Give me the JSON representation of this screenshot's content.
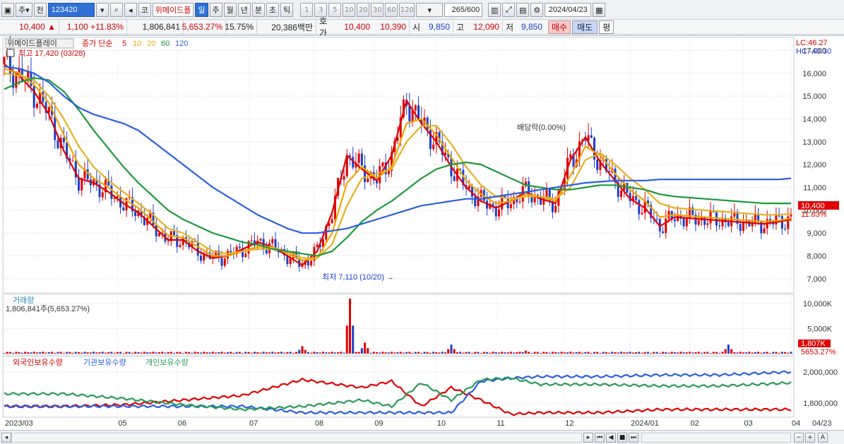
{
  "toolbar": {
    "chart_type": "주",
    "market": "전",
    "stock_code": "123420",
    "stock_name": "위메이드플",
    "periods": [
      "일",
      "주",
      "월",
      "년",
      "분",
      "초",
      "틱"
    ],
    "active_period": "일",
    "intervals": [
      "1",
      "3",
      "5",
      "10",
      "20",
      "30",
      "60",
      "120"
    ],
    "count": "265",
    "count_max": "/600",
    "date": "2024/04/23"
  },
  "quote": {
    "price": "10,400",
    "change": "1,100",
    "change_pct": "+11.83%",
    "volume": "1,806,841",
    "volume_ratio": "5,653.27%",
    "turnover": "15.75%",
    "amount": "20,386백만",
    "bid_label": "호가",
    "bid1": "10,400",
    "bid2": "10,390",
    "open_label": "시",
    "open": "9,850",
    "high_label": "고",
    "high": "12,090",
    "low_label": "저",
    "low": "9,850",
    "buy": "매수",
    "sell": "매도",
    "eval": "평"
  },
  "colors": {
    "up": "#e00000",
    "down": "#1a3fcf",
    "ma5": "#e00000",
    "ma10": "#f0a500",
    "ma20": "#e8b020",
    "ma60": "#1a9a3a",
    "ma120": "#2a5fe0",
    "foreign": "#e00000",
    "institution": "#2a5fe0",
    "individual": "#2a9a5a"
  },
  "price_panel": {
    "legend_name": "위메이드플레이",
    "legend_main": "종가 단순",
    "ma_labels": [
      "5",
      "10",
      "20",
      "60",
      "120"
    ],
    "high_note": "최고 17,420 (03/28)",
    "low_note": "최저 7,110 (10/20) →",
    "dividend_note": "배당락(0.00%)",
    "lc": "LC:46.27",
    "hc": "HC:-40.30",
    "last_price_tag": "10,400",
    "last_pct_tag": "11.83%"
  },
  "volume_panel": {
    "title": "거래량",
    "value": "1,806,841주(5,653.27%)",
    "tag_value": "1,807K",
    "tag_pct": "5653.27%"
  },
  "holdings_panel": {
    "legend": [
      "외국인보유수량",
      "기관보유수량",
      "개인보유수량"
    ]
  },
  "x_axis": {
    "labels": [
      "2023/03",
      "05",
      "06",
      "07",
      "08",
      "09",
      "10",
      "11",
      "12",
      "2024/01",
      "02",
      "03",
      "04",
      "04/23"
    ]
  },
  "chart_data": [
    {
      "type": "line",
      "name": "price",
      "ylim": [
        6500,
        17200
      ],
      "yticks": [
        "7,000",
        "8,000",
        "9,000",
        "10,000",
        "11,000",
        "12,000",
        "13,000",
        "14,000",
        "15,000",
        "16,000",
        "17,000"
      ],
      "x": [
        0,
        5,
        10,
        15,
        20,
        25,
        30,
        35,
        40,
        45,
        50,
        55,
        60,
        65,
        70,
        75,
        80,
        85,
        90,
        95,
        100,
        105,
        110,
        115,
        120,
        125,
        130,
        135,
        140,
        145,
        150,
        155,
        160,
        165,
        170,
        175,
        180,
        185,
        190,
        195,
        200,
        205,
        210,
        215,
        220,
        225,
        230,
        235,
        240,
        245,
        250,
        255,
        260,
        264
      ],
      "series": [
        {
          "name": "5",
          "values": [
            16400,
            15900,
            15200,
            14200,
            12600,
            11400,
            11200,
            10800,
            10300,
            9900,
            9300,
            8700,
            8700,
            8200,
            7900,
            8000,
            8300,
            8600,
            8400,
            8000,
            7600,
            8200,
            9900,
            12400,
            11800,
            11300,
            12400,
            14800,
            13800,
            13000,
            11900,
            11000,
            10400,
            10100,
            10400,
            10800,
            10500,
            10300,
            12200,
            13200,
            12100,
            11300,
            10500,
            10100,
            9300,
            9700,
            9650,
            9600,
            9550,
            9500,
            9450,
            9400,
            9500,
            9600
          ]
        },
        {
          "name": "10",
          "values": [
            16200,
            16000,
            15500,
            14700,
            13300,
            12000,
            11400,
            11000,
            10500,
            10100,
            9500,
            8900,
            8800,
            8400,
            8000,
            8000,
            8200,
            8400,
            8400,
            8100,
            7800,
            7900,
            9000,
            11200,
            11900,
            11400,
            11900,
            13800,
            14000,
            13300,
            12300,
            11300,
            10700,
            10300,
            10400,
            10700,
            10600,
            10400,
            11500,
            12800,
            12400,
            11600,
            10900,
            10400,
            9700,
            9800,
            9750,
            9700,
            9650,
            9600,
            9550,
            9500,
            9550,
            9650
          ]
        },
        {
          "name": "20",
          "values": [
            16000,
            15900,
            15700,
            15000,
            14000,
            12800,
            11900,
            11300,
            10800,
            10300,
            9800,
            9200,
            9000,
            8600,
            8200,
            8100,
            8200,
            8300,
            8300,
            8200,
            7900,
            7900,
            8500,
            10200,
            11400,
            11600,
            11800,
            13000,
            13700,
            13700,
            12900,
            11900,
            11100,
            10600,
            10500,
            10600,
            10600,
            10500,
            11000,
            12200,
            12500,
            12000,
            11400,
            10900,
            10300,
            10100,
            10050,
            10000,
            9950,
            9900,
            9850,
            9800,
            9800,
            9850
          ]
        },
        {
          "name": "60",
          "values": [
            15300,
            15600,
            15800,
            15700,
            15200,
            14400,
            13500,
            12700,
            11900,
            11200,
            10600,
            10000,
            9600,
            9300,
            9000,
            8800,
            8600,
            8500,
            8300,
            8200,
            8100,
            8000,
            8200,
            8800,
            9500,
            10000,
            10400,
            10900,
            11400,
            11800,
            12000,
            12100,
            12000,
            11700,
            11400,
            11100,
            11000,
            10900,
            10900,
            11000,
            11100,
            11100,
            11000,
            10900,
            10700,
            10600,
            10550,
            10500,
            10450,
            10400,
            10350,
            10300,
            10300,
            10300
          ]
        },
        {
          "name": "120",
          "values": [
            16300,
            16200,
            16000,
            15600,
            15000,
            14500,
            14200,
            14000,
            13800,
            13500,
            13000,
            12500,
            12000,
            11500,
            11000,
            10600,
            10200,
            9800,
            9500,
            9200,
            9000,
            9000,
            9100,
            9200,
            9400,
            9600,
            9800,
            10000,
            10200,
            10300,
            10400,
            10500,
            10500,
            10600,
            10700,
            10800,
            10900,
            11000,
            11100,
            11200,
            11250,
            11300,
            11300,
            11300,
            11350,
            11350,
            11350,
            11350,
            11350,
            11350,
            11350,
            11350,
            11350,
            11400
          ]
        }
      ]
    },
    {
      "type": "bar",
      "name": "volume",
      "ylim": [
        0,
        11000
      ],
      "yticks": [
        "5,000K",
        "10,000K"
      ],
      "spikes_x": [
        100,
        116,
        121,
        150,
        175,
        243
      ],
      "spikes_values": [
        1500,
        11200,
        2200,
        1800,
        600,
        1807
      ]
    },
    {
      "type": "line",
      "name": "holdings",
      "ylim": [
        1720000,
        2080000
      ],
      "yticks": [
        "1,800,000",
        "2,000,000"
      ],
      "x": [
        0,
        20,
        40,
        60,
        80,
        100,
        120,
        130,
        140,
        150,
        160,
        170,
        180,
        200,
        220,
        240,
        264
      ],
      "series": [
        {
          "name": "외국인보유수량",
          "values": [
            1780000,
            1780000,
            1790000,
            1820000,
            1850000,
            1950000,
            1900000,
            1940000,
            1780000,
            1900000,
            1820000,
            1730000,
            1740000,
            1740000,
            1760000,
            1760000,
            1760000
          ]
        },
        {
          "name": "기관보유수량",
          "values": [
            1780000,
            1780000,
            1780000,
            1780000,
            1780000,
            1740000,
            1740000,
            1740000,
            1740000,
            1740000,
            1940000,
            1960000,
            1970000,
            1970000,
            1980000,
            1980000,
            2000000
          ]
        },
        {
          "name": "개인보유수량",
          "values": [
            1860000,
            1860000,
            1830000,
            1790000,
            1760000,
            1780000,
            1820000,
            1780000,
            1930000,
            1820000,
            1950000,
            1960000,
            1920000,
            1920000,
            1910000,
            1910000,
            1930000
          ]
        }
      ]
    }
  ]
}
